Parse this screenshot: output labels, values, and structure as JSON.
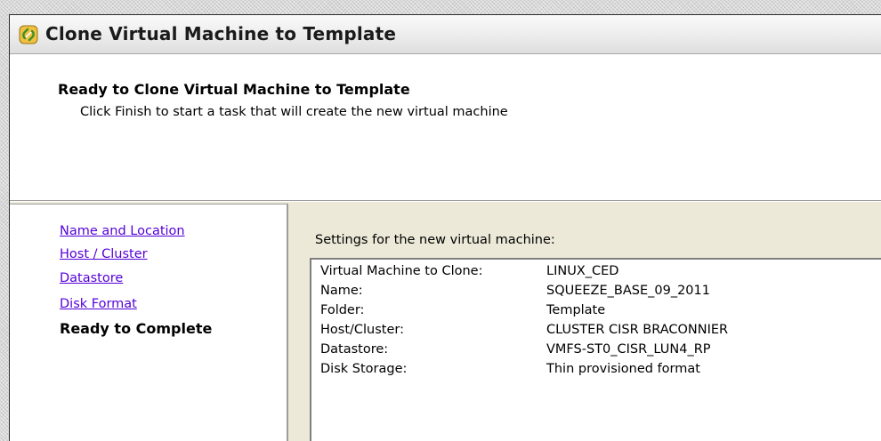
{
  "window": {
    "title": "Clone Virtual Machine to Template",
    "icon": "clone-wizard-icon"
  },
  "header": {
    "heading": "Ready to Clone Virtual Machine to Template",
    "subtitle": "Click Finish to start a task that will create the new virtual machine"
  },
  "nav": {
    "items": [
      {
        "label": "Name and Location",
        "state": "link"
      },
      {
        "label": "Host / Cluster",
        "state": "link"
      },
      {
        "label": "Datastore",
        "state": "link"
      },
      {
        "label": "Disk Format",
        "state": "link"
      },
      {
        "label": "Ready to Complete",
        "state": "current"
      }
    ]
  },
  "settings": {
    "label": "Settings for the new virtual machine:",
    "rows": [
      {
        "key": "Virtual Machine to Clone:",
        "value": "LINUX_CED"
      },
      {
        "key": "Name:",
        "value": "SQUEEZE_BASE_09_2011"
      },
      {
        "key": "Folder:",
        "value": "Template"
      },
      {
        "key": "Host/Cluster:",
        "value": "CLUSTER CISR BRACONNIER"
      },
      {
        "key": "Datastore:",
        "value": "VMFS-ST0_CISR_LUN4_RP"
      },
      {
        "key": "Disk Storage:",
        "value": "Thin provisioned format"
      }
    ]
  },
  "colors": {
    "link": "#5400d8",
    "window_bg": "#ece9d8",
    "panel_bg": "#ffffff"
  }
}
